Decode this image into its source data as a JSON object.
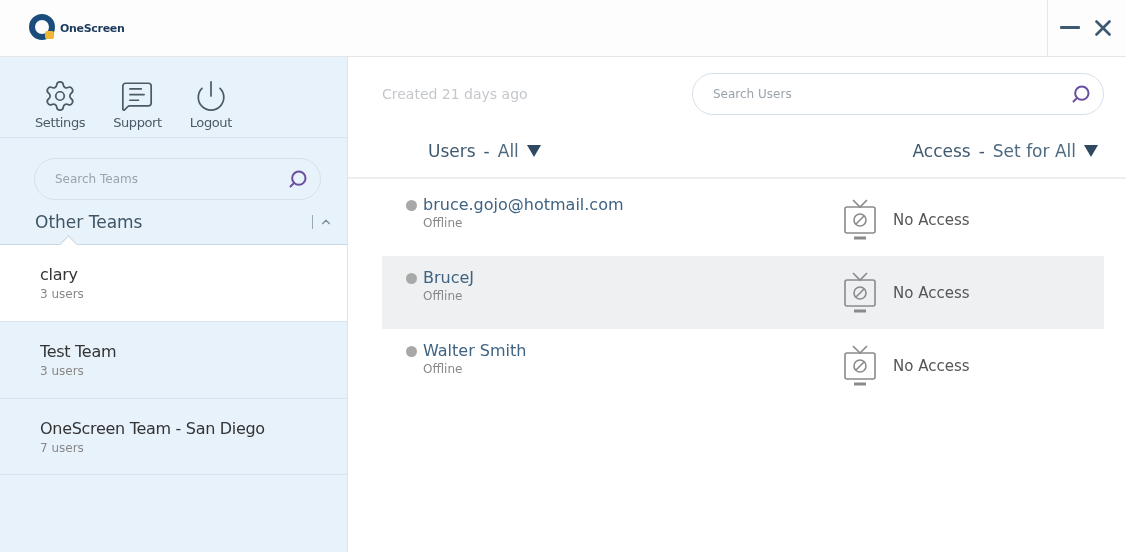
{
  "app": {
    "logo_text": "OneScreen"
  },
  "sidebar": {
    "toolbar": [
      {
        "kind": "settings",
        "label": "Settings"
      },
      {
        "kind": "support",
        "label": "Support"
      },
      {
        "kind": "logout",
        "label": "Logout"
      }
    ],
    "search": {
      "placeholder": "Search Teams"
    },
    "section": {
      "title": "Other Teams",
      "expanded": true
    },
    "teams": [
      {
        "name": "clary",
        "count": "3 users",
        "selected": true
      },
      {
        "name": "Test Team",
        "count": "3 users",
        "selected": false
      },
      {
        "name": "OneScreen Team - San Diego",
        "count": "7 users",
        "selected": false
      }
    ]
  },
  "main": {
    "created": "Created 21 days ago",
    "search": {
      "placeholder": "Search Users"
    },
    "users_header": {
      "label": "Users",
      "separator": "-",
      "filter": "All"
    },
    "access_header": {
      "label": "Access",
      "separator": "-",
      "filter": "Set for All"
    },
    "users": [
      {
        "name": "bruce.gojo@hotmail.com",
        "status": "Offline",
        "access": "No Access",
        "highlighted": false
      },
      {
        "name": "BruceJ",
        "status": "Offline",
        "access": "No Access",
        "highlighted": true
      },
      {
        "name": "Walter Smith",
        "status": "Offline",
        "access": "No Access",
        "highlighted": false
      }
    ]
  }
}
